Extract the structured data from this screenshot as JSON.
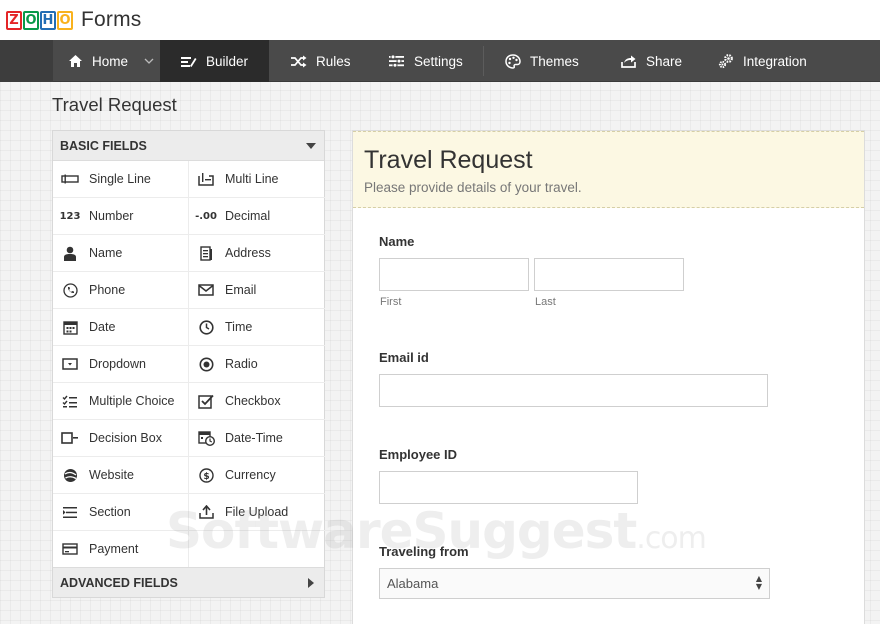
{
  "brand": {
    "logo_letters": [
      "Z",
      "O",
      "H",
      "O"
    ],
    "logo_colors": [
      "#e42527",
      "#089949",
      "#226db4",
      "#f9b21d"
    ],
    "app_name": "Forms"
  },
  "nav": {
    "items": [
      {
        "label": "Home",
        "icon": "home-icon"
      },
      {
        "label": "Builder",
        "icon": "builder-icon",
        "active": true
      },
      {
        "label": "Rules",
        "icon": "shuffle-icon"
      },
      {
        "label": "Settings",
        "icon": "settings-icon"
      },
      {
        "label": "Themes",
        "icon": "palette-icon"
      },
      {
        "label": "Share",
        "icon": "share-icon"
      },
      {
        "label": "Integration",
        "icon": "gears-icon"
      }
    ]
  },
  "page": {
    "title": "Travel Request"
  },
  "palette": {
    "basic_header": "BASIC FIELDS",
    "advanced_header": "ADVANCED FIELDS",
    "fields": [
      {
        "label": "Single Line",
        "icon": "single-line-icon"
      },
      {
        "label": "Multi Line",
        "icon": "multi-line-icon"
      },
      {
        "label": "Number",
        "icon": "number-icon",
        "glyph": "123"
      },
      {
        "label": "Decimal",
        "icon": "decimal-icon",
        "glyph": "-.00"
      },
      {
        "label": "Name",
        "icon": "person-icon"
      },
      {
        "label": "Address",
        "icon": "address-icon"
      },
      {
        "label": "Phone",
        "icon": "phone-icon"
      },
      {
        "label": "Email",
        "icon": "envelope-icon"
      },
      {
        "label": "Date",
        "icon": "calendar-icon"
      },
      {
        "label": "Time",
        "icon": "clock-icon"
      },
      {
        "label": "Dropdown",
        "icon": "dropdown-icon"
      },
      {
        "label": "Radio",
        "icon": "radio-icon"
      },
      {
        "label": "Multiple Choice",
        "icon": "multiple-choice-icon"
      },
      {
        "label": "Checkbox",
        "icon": "checkbox-icon"
      },
      {
        "label": "Decision Box",
        "icon": "decision-box-icon"
      },
      {
        "label": "Date-Time",
        "icon": "date-time-icon"
      },
      {
        "label": "Website",
        "icon": "globe-icon"
      },
      {
        "label": "Currency",
        "icon": "currency-icon"
      },
      {
        "label": "Section",
        "icon": "section-icon"
      },
      {
        "label": "File Upload",
        "icon": "upload-icon"
      },
      {
        "label": "Payment",
        "icon": "credit-card-icon"
      }
    ]
  },
  "form": {
    "title": "Travel Request",
    "description": "Please provide details of your travel.",
    "name_label": "Name",
    "first_sub": "First",
    "last_sub": "Last",
    "email_label": "Email id",
    "employee_label": "Employee ID",
    "traveling_label": "Traveling from",
    "traveling_value": "Alabama"
  },
  "watermark": {
    "main": "SoftwareSuggest",
    "suffix": ".com"
  }
}
